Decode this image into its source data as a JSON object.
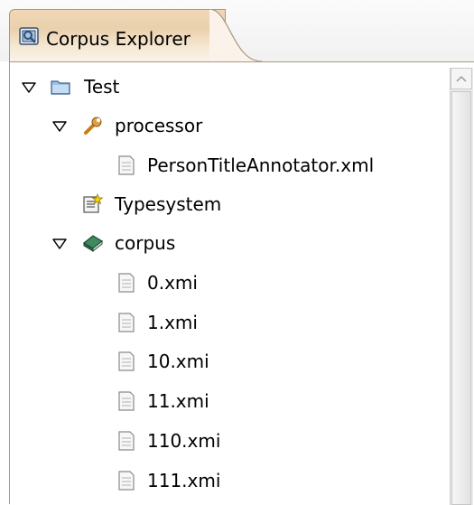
{
  "view": {
    "tab_title": "Corpus Explorer",
    "tab_icon": "corpus-explorer-icon"
  },
  "tree": {
    "nodes": [
      {
        "label": "Test",
        "icon": "project-folder-icon",
        "expanded": true
      },
      {
        "label": "processor",
        "icon": "wrench-icon",
        "expanded": true
      },
      {
        "label": "PersonTitleAnnotator.xml",
        "icon": "file-icon"
      },
      {
        "label": "Typesystem",
        "icon": "typesystem-icon"
      },
      {
        "label": "corpus",
        "icon": "book-icon",
        "expanded": true
      },
      {
        "label": "0.xmi",
        "icon": "file-icon"
      },
      {
        "label": "1.xmi",
        "icon": "file-icon"
      },
      {
        "label": "10.xmi",
        "icon": "file-icon"
      },
      {
        "label": "11.xmi",
        "icon": "file-icon"
      },
      {
        "label": "110.xmi",
        "icon": "file-icon"
      },
      {
        "label": "111.xmi",
        "icon": "file-icon"
      }
    ]
  }
}
